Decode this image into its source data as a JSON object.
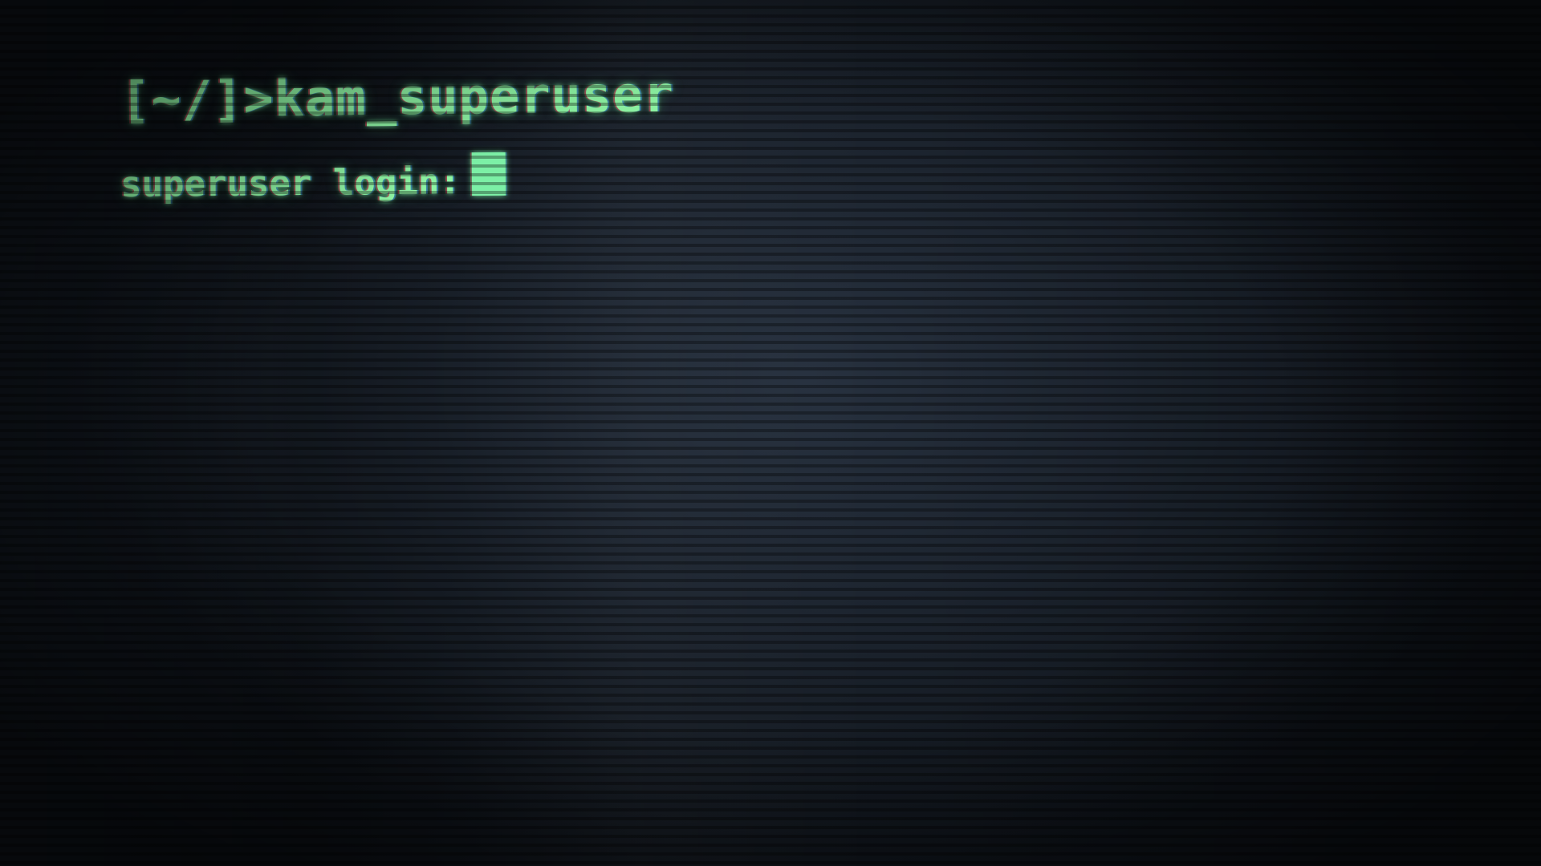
{
  "terminal": {
    "prompt": "[~/]>",
    "command": "kam_superuser",
    "login_label": "superuser login:",
    "input_value": ""
  },
  "colors": {
    "text": "#8ef5a4",
    "cursor": "#7cf0a6",
    "background": "#1d2530"
  }
}
